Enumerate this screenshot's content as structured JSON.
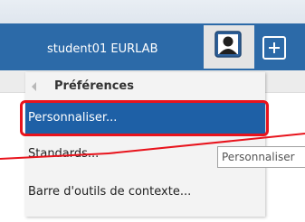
{
  "header": {
    "user_label": "student01 EURLAB"
  },
  "menu": {
    "back_label": "Préférences",
    "items": [
      {
        "label": "Personnaliser...",
        "selected": true
      },
      {
        "label": "Standards..."
      },
      {
        "label": "Barre d'outils de contexte..."
      }
    ]
  },
  "tooltip": {
    "text": "Personnaliser"
  },
  "colors": {
    "header_blue": "#2c6aa8",
    "selected_blue": "#1e60a6",
    "highlight_red": "#e8131c"
  },
  "icons": {
    "avatar": "user-avatar-icon",
    "add": "plus-icon",
    "back": "chevron-left-icon"
  }
}
